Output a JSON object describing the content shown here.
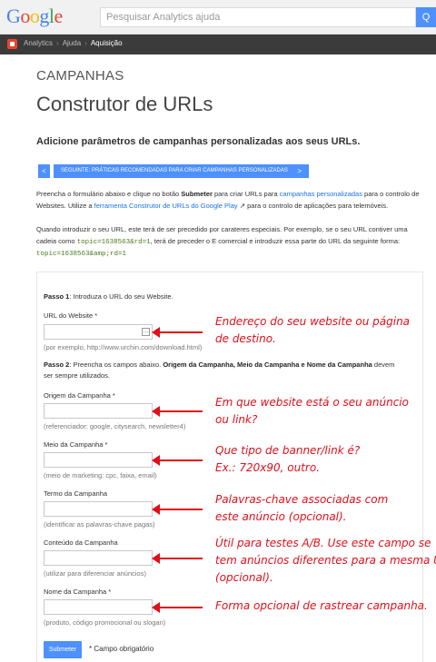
{
  "header": {
    "logo_letters": [
      "G",
      "o",
      "o",
      "g",
      "l",
      "e"
    ],
    "search_placeholder": "Pesquisar Analytics ajuda",
    "search_button": "Q"
  },
  "breadcrumb": {
    "items": [
      "Analytics",
      "Ajuda",
      "Aquisição"
    ]
  },
  "page": {
    "section": "CAMPANHAS",
    "title": "Construtor de URLs",
    "subtitle": "Adicione parâmetros de campanhas personalizadas aos seus URLs.",
    "prev_button": "<",
    "next_button": "SEGUINTE: PRÁTICAS RECOMENDADAS PARA CRIAR CAMPANHAS PERSONALIZADAS",
    "next_chevron": ">"
  },
  "intro": {
    "p1_a": "Preencha o formulário abaixo e clique no botão ",
    "p1_b": "Submeter",
    "p1_c": " para criar URLs para ",
    "p1_link1": "campanhas personalizadas",
    "p1_d": " para o controlo de Websites. Utilize a ",
    "p1_link2": "ferramenta Construtor de URLs do Google Play",
    "p1_e": " para o controlo de aplicações para telemóveis.",
    "p2_a": "Quando introduzir o seu URL, este terá de ser precedido por carateres especiais. Por exemplo, se o seu URL contiver uma cadeia como ",
    "p2_code1": "topic=1638563&rd=1",
    "p2_b": ", terá de preceder o E comercial e introduzir essa parte do URL da seguinte forma: ",
    "p2_code2": "topic=1638563&amp;rd=1"
  },
  "form": {
    "step1_label": "Passo 1",
    "step1_text": ": Introduza o URL do seu Website.",
    "url_label": "URL do Website *",
    "url_value": "",
    "url_hint": "(por exemplo, http://www.urchin.com/download.html)",
    "step2_label": "Passo 2",
    "step2_text_a": ": Preencha os campos abaixo. ",
    "step2_bold": "Origem da Campanha, Meio da Campanha e Nome da Campanha",
    "step2_text_b": " devem",
    "step2_line2": "ser sempre utilizados.",
    "fields": [
      {
        "label": "Origem da Campanha *",
        "value": "",
        "hint": "(referenciador: google, citysearch, newsletter4)"
      },
      {
        "label": "Meio da Campanha *",
        "value": "",
        "hint": "(meio de marketing: cpc, faixa, email)"
      },
      {
        "label": "Termo da Campanha",
        "value": "",
        "hint": "(identificar as palavras-chave pagas)"
      },
      {
        "label": "Conteúdo da Campanha",
        "value": "",
        "hint": "(utilizar para diferenciar anúncios)"
      },
      {
        "label": "Nome da Campanha *",
        "value": "",
        "hint": "(produto, código promocional ou slogan)"
      }
    ],
    "submit_label": "Submeter",
    "required_note": "* Campo obrigatório"
  },
  "annotations": {
    "color": "#e0101b",
    "items": [
      [
        "Endereço do seu website ou página",
        "de destino."
      ],
      [
        "Em que website está o seu anúncio",
        "ou link?"
      ],
      [
        "Que tipo de banner/link é?",
        "Ex.: 720x90, outro."
      ],
      [
        "Palavras-chave associadas com",
        "este anúncio (opcional)."
      ],
      [
        "Útil para testes A/B. Use este campo se",
        "tem anúncios diferentes para a mesma URL",
        "(opcional)."
      ],
      [
        "Forma opcional de rastrear campanha."
      ]
    ]
  }
}
